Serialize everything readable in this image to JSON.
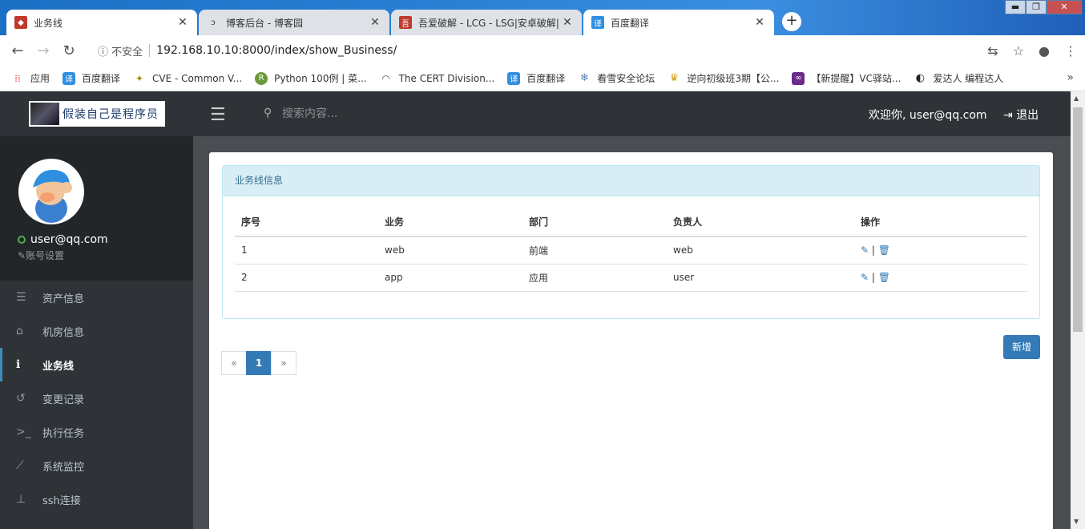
{
  "browser": {
    "tabs": [
      {
        "title": "业务线",
        "icon": "app-favicon",
        "active": true
      },
      {
        "title": "博客后台 - 博客园",
        "icon": "cnblogs-favicon",
        "active": false
      },
      {
        "title": "吾爱破解 - LCG - LSG|安卓破解|",
        "icon": "52pojie-favicon",
        "active": false
      },
      {
        "title": "百度翻译",
        "icon": "baidu-translate-favicon",
        "active": true
      }
    ],
    "new_tab": "+",
    "window_controls": {
      "minimize": "▬",
      "maximize": "❐",
      "close": "✕"
    },
    "security_label": "不安全",
    "url": "192.168.10.10:8000/index/show_Business/",
    "bookmarks": [
      {
        "label": "应用",
        "icon": "apps-grid-icon",
        "color": "#e44"
      },
      {
        "label": "百度翻译",
        "icon": "translate-icon",
        "color": "#2f8fe0"
      },
      {
        "label": "CVE - Common V...",
        "icon": "cve-icon",
        "color": "#b8860b"
      },
      {
        "label": "Python 100例 | 菜...",
        "icon": "runoob-icon",
        "color": "#6a9a3a"
      },
      {
        "label": "The CERT Division...",
        "icon": "cert-icon",
        "color": "#456"
      },
      {
        "label": "百度翻译",
        "icon": "translate-icon",
        "color": "#2f8fe0"
      },
      {
        "label": "看雪安全论坛",
        "icon": "snowflake-icon",
        "color": "#5b7fb0"
      },
      {
        "label": "逆向初级班3期【公...",
        "icon": "trophy-icon",
        "color": "#d4a017"
      },
      {
        "label": "【新提醒】VC驿站...",
        "icon": "vs-icon",
        "color": "#6a2a8a"
      },
      {
        "label": "爱达人 编程达人",
        "icon": "ai-icon",
        "color": "#222"
      }
    ],
    "bookmarks_more": "»"
  },
  "header": {
    "logo_text": "假装自己是程序员",
    "search_placeholder": "搜索内容...",
    "welcome": "欢迎你, user@qq.com",
    "logout": "退出"
  },
  "sidebar": {
    "username": "user@qq.com",
    "account_settings": "账号设置",
    "items": [
      {
        "label": "资产信息",
        "icon": "server-icon",
        "glyph": "☰",
        "active": false
      },
      {
        "label": "机房信息",
        "icon": "home-icon",
        "glyph": "⌂",
        "active": false
      },
      {
        "label": "业务线",
        "icon": "info-icon",
        "glyph": "ℹ",
        "active": true
      },
      {
        "label": "变更记录",
        "icon": "history-icon",
        "glyph": "↺",
        "active": false
      },
      {
        "label": "执行任务",
        "icon": "terminal-icon",
        "glyph": ">_",
        "active": false
      },
      {
        "label": "系统监控",
        "icon": "line-chart-icon",
        "glyph": "📈",
        "active": false
      },
      {
        "label": "ssh连接",
        "icon": "sitemap-icon",
        "glyph": "⊥",
        "active": false
      }
    ]
  },
  "main": {
    "panel_title": "业务线信息",
    "columns": [
      "序号",
      "业务",
      "部门",
      "负责人",
      "操作"
    ],
    "rows": [
      {
        "id": "1",
        "business": "web",
        "dept": "前端",
        "owner": "web"
      },
      {
        "id": "2",
        "business": "app",
        "dept": "应用",
        "owner": "user"
      }
    ],
    "add_button": "新增",
    "pagination": {
      "prev": "«",
      "current": "1",
      "next": "»"
    }
  }
}
